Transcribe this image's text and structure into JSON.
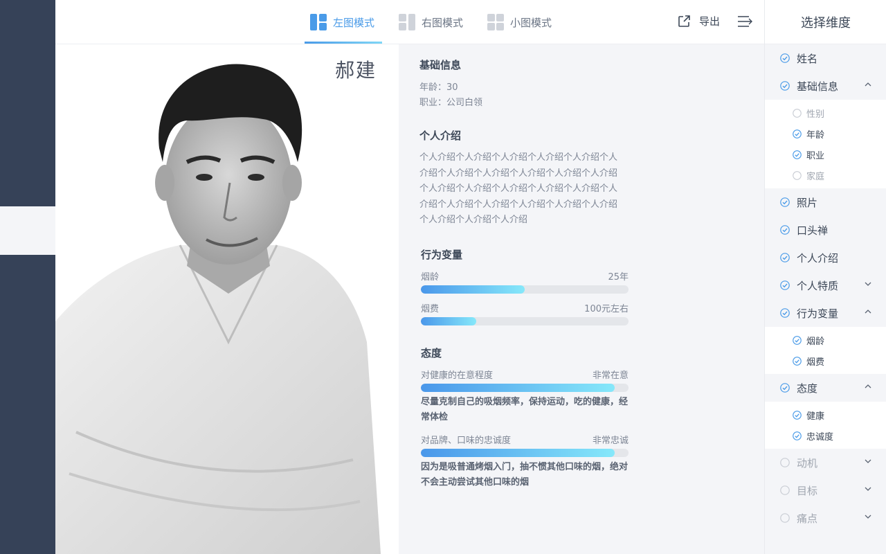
{
  "tabs": [
    {
      "label": "左图模式",
      "active": true,
      "icon": "layout-left-icon"
    },
    {
      "label": "右图模式",
      "active": false,
      "icon": "layout-right-icon"
    },
    {
      "label": "小图模式",
      "active": false,
      "icon": "layout-grid-icon"
    }
  ],
  "toolbar": {
    "export_label": "导出",
    "export_icon": "export-icon",
    "menu_icon": "menu-collapse-icon"
  },
  "person": {
    "name": "郝建"
  },
  "basic": {
    "title": "基础信息",
    "age": "年龄：30",
    "job": "职业：公司白领"
  },
  "intro": {
    "title": "个人介绍",
    "text": "个人介绍个人介绍个人介绍个人介绍个人介绍个人介绍个人介绍个人介绍个人介绍个人介绍个人介绍个人介绍个人介绍个人介绍个人介绍个人介绍个人介绍个人介绍个人介绍个人介绍个人介绍个人介绍个人介绍个人介绍个人介绍"
  },
  "behavior": {
    "title": "行为变量",
    "bars": [
      {
        "label": "烟龄",
        "value": "25年",
        "fill": 0.5
      },
      {
        "label": "烟费",
        "value": "100元左右",
        "fill": 0.267
      }
    ]
  },
  "attitude": {
    "title": "态度",
    "bars": [
      {
        "label": "对健康的在意程度",
        "value": "非常在意",
        "fill": 0.933,
        "desc": "尽量克制自己的吸烟频率，保持运动，吃的健康，经常体检"
      },
      {
        "label": "对品牌、口味的忠诚度",
        "value": "非常忠诚",
        "fill": 0.933,
        "desc": "因为是吸普通烤烟入门，抽不惯其他口味的烟，绝对不会主动尝试其他口味的烟"
      }
    ]
  },
  "panel": {
    "title": "选择维度",
    "items": [
      {
        "label": "姓名",
        "checked": true
      },
      {
        "label": "基础信息",
        "checked": true,
        "chevron": "up"
      },
      {
        "label": "性别",
        "checked": false,
        "sub": true
      },
      {
        "label": "年龄",
        "checked": true,
        "sub": true
      },
      {
        "label": "职业",
        "checked": true,
        "sub": true
      },
      {
        "label": "家庭",
        "checked": false,
        "sub": true
      },
      {
        "label": "照片",
        "checked": true
      },
      {
        "label": "口头禅",
        "checked": true
      },
      {
        "label": "个人介绍",
        "checked": true
      },
      {
        "label": "个人特质",
        "checked": true,
        "chevron": "down"
      },
      {
        "label": "行为变量",
        "checked": true,
        "chevron": "up"
      },
      {
        "label": "烟龄",
        "checked": true,
        "sub": true
      },
      {
        "label": "烟费",
        "checked": true,
        "sub": true
      },
      {
        "label": "态度",
        "checked": true,
        "chevron": "up"
      },
      {
        "label": "健康",
        "checked": true,
        "sub": true
      },
      {
        "label": "忠诚度",
        "checked": true,
        "sub": true
      },
      {
        "label": "动机",
        "checked": false,
        "chevron": "down"
      },
      {
        "label": "目标",
        "checked": false,
        "chevron": "down"
      },
      {
        "label": "痛点",
        "checked": false,
        "chevron": "down"
      }
    ]
  },
  "colors": {
    "accent": "#4a9be8",
    "rail": "#364258",
    "panel_bg": "#f4f5f8"
  }
}
